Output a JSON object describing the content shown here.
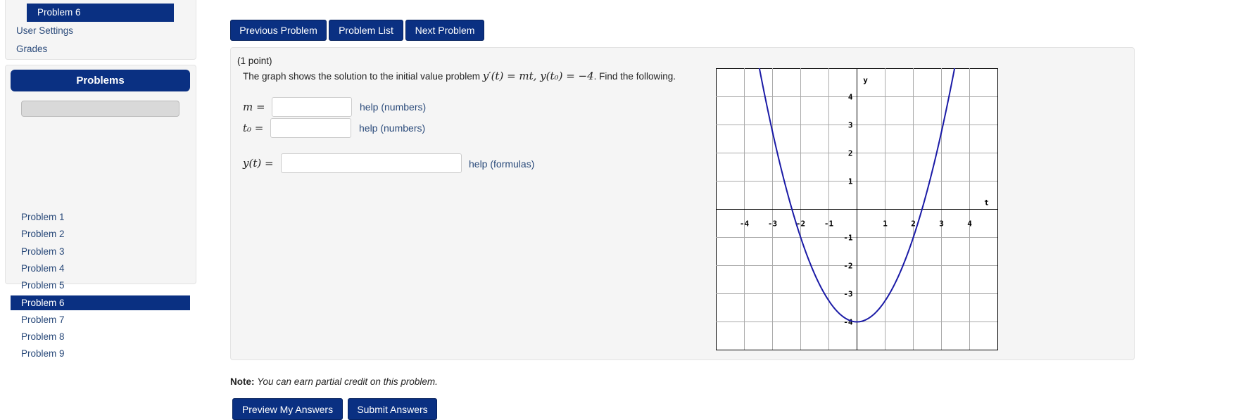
{
  "sidebar": {
    "current_problem": "Problem 6",
    "links": [
      "User Settings",
      "Grades"
    ],
    "problems_title": "Problems",
    "problems": [
      "Problem 1",
      "Problem 2",
      "Problem 3",
      "Problem 4",
      "Problem 5",
      "Problem 6",
      "Problem 7",
      "Problem 8",
      "Problem 9"
    ],
    "active_index": 5
  },
  "nav": {
    "previous": "Previous Problem",
    "list": "Problem List",
    "next": "Next Problem"
  },
  "problem": {
    "points": "(1 point)",
    "statement_pre": "The graph shows the solution to the initial value problem ",
    "statement_math": "y′(t) = mt, y(t₀) = −4",
    "statement_post": ". Find the following.",
    "fields": [
      {
        "label": "m =",
        "value": "",
        "help": "help (numbers)"
      },
      {
        "label": "t₀ =",
        "value": "",
        "help": "help (numbers)"
      },
      {
        "label": "y(t) =",
        "value": "",
        "help": "help (formulas)"
      }
    ]
  },
  "note": {
    "label": "Note:",
    "text": "You can earn partial credit on this problem."
  },
  "actions": {
    "preview": "Preview My Answers",
    "submit": "Submit Answers"
  },
  "chart_data": {
    "type": "line",
    "xlabel": "t",
    "ylabel": "y",
    "xlim": [
      -5,
      5
    ],
    "ylim": [
      -5,
      5
    ],
    "xticks": [
      -4,
      -3,
      -2,
      -1,
      1,
      2,
      3,
      4
    ],
    "yticks": [
      -4,
      -3,
      -2,
      -1,
      1,
      2,
      3,
      4
    ],
    "grid": true,
    "series": [
      {
        "function": "0.75*t^2 - 4",
        "color": "#1a1aa6",
        "x": [
          -3.5,
          -3,
          -2.5,
          -2,
          -1.5,
          -1,
          -0.5,
          0,
          0.5,
          1,
          1.5,
          2,
          2.5,
          3,
          3.5
        ],
        "y": [
          5.19,
          2.75,
          0.69,
          -1,
          -2.31,
          -3.25,
          -3.81,
          -4,
          -3.81,
          -3.25,
          -2.31,
          -1,
          0.69,
          2.75,
          5.19
        ]
      }
    ]
  }
}
